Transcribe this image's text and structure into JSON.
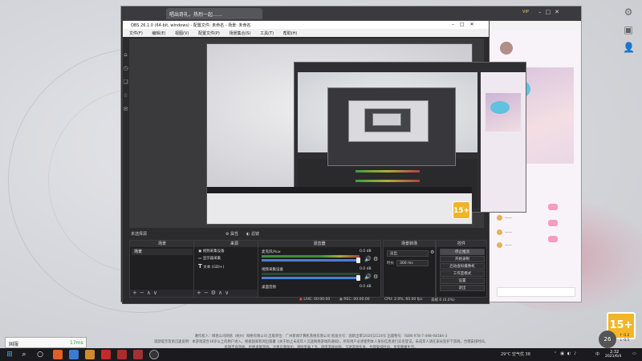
{
  "browser": {
    "tab_title": "唱出奇礼，热烈一起……",
    "vip_label": "VIP"
  },
  "obs": {
    "title": "OBS 26.1.0 (64-bit, windows) - 配置文件: 未命名 - 场景: 未命名",
    "menu": [
      "文件(F)",
      "编辑(E)",
      "视图(V)",
      "配置文件(P)",
      "场景集合(S)",
      "工具(T)",
      "帮助(H)"
    ],
    "status_strip": {
      "no_source": "未选择源",
      "properties": "属性",
      "filters": "滤镜"
    },
    "docks": {
      "scenes": {
        "title": "场景",
        "items": [
          "场景"
        ]
      },
      "sources": {
        "title": "来源",
        "items": [
          {
            "label": "视频采集设备"
          },
          {
            "label": "显示器采集"
          },
          {
            "label": "文本 (GDI+)"
          }
        ]
      },
      "mixer": {
        "title": "混音器",
        "rows": [
          {
            "name": "麦克风/Aux",
            "db": "0.0 dB"
          },
          {
            "name": "视频采集设备",
            "db": "0.0 dB"
          },
          {
            "name": "桌面音频",
            "db": "0.0 dB"
          }
        ]
      },
      "transitions": {
        "title": "场景转场",
        "type": "淡出",
        "duration_label": "时长",
        "duration_value": "300 ms"
      },
      "controls": {
        "title": "控件",
        "buttons": [
          "停止推流",
          "开始录制",
          "启动虚拟摄像机",
          "工作室模式",
          "设置",
          "退出"
        ]
      }
    },
    "bottom_status": {
      "live": "LIVE: 00:00:00",
      "rec": "REC: 00:00:00",
      "cpu": "CPU: 2.0%, 60.00 fps",
      "dropped": "丢帧 0 (0.0%)"
    }
  },
  "nested_capture": {
    "badge": "15+"
  },
  "overlay": {
    "ping_name": "国服",
    "ping_value": "17ms",
    "badge": "15+",
    "round_badge": "26",
    "net_up": "0.2",
    "net_down": "0.1",
    "footer_lines": [
      "著作权人：网易公司网易（杭州）网络有限公司  出版单位：广州新闻计算机系统有限公司  批准文号：国新出审[2020]2124号  出版物号：ISBN 978-7-498-08184-3",
      "适龄提示及防沉迷说明：本游戏适合16岁以上的用户进入。根据国家新闻出版署《关于防止未成年人沉迷网络游戏的通知》，所有用户必须使用本人身份信息进行实名登记。未成年人请在家长监护下游戏，合理安排时间。",
      "抵制不良游戏，拒绝盗版游戏。注意自我保护，谨防受骗上当。适度游戏益脑，沉迷游戏伤身。合理安排时间，享受健康生活。"
    ]
  },
  "taskbar": {
    "weather": "29°C 空气优 38",
    "ime": "中",
    "time": "2:32",
    "date": "2021/6/4"
  },
  "colors": {
    "obs_bg": "#2b2b2e",
    "meter_green": "#3b8f3b",
    "meter_red": "#a84040",
    "slider_blue": "#4a7fd4",
    "badge_orange": "#f4b52a"
  }
}
